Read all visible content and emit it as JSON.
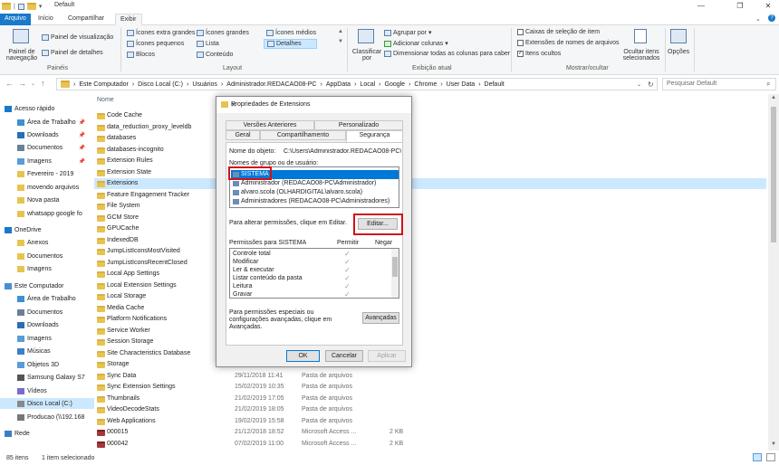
{
  "window": {
    "title": "Default"
  },
  "tabs": [
    {
      "label": "Arquivo"
    },
    {
      "label": "Início"
    },
    {
      "label": "Compartilhar"
    },
    {
      "label": "Exibir"
    }
  ],
  "ribbon": {
    "panes": {
      "nav_pane": "Painel de navegação",
      "preview_pane": "Painel de visualização",
      "details_pane": "Painel de detalhes",
      "group_label": "Painéis"
    },
    "layout": {
      "items": [
        "Ícones extra grandes",
        "Ícones grandes",
        "Ícones médios",
        "Ícones pequenos",
        "Lista",
        "Detalhes",
        "Blocos",
        "Conteúdo"
      ],
      "group_label": "Layout"
    },
    "current_view": {
      "sort_by": "Classificar por",
      "group_by": "Agrupar por",
      "add_columns": "Adicionar colunas",
      "size_columns": "Dimensionar todas as colunas para caber",
      "group_label": "Exibição atual"
    },
    "show_hide": {
      "item_checkboxes": "Caixas de seleção de item",
      "file_extensions": "Extensões de nomes de arquivos",
      "hidden_items": "Itens ocultos",
      "hide_selected": "Ocultar itens selecionados",
      "group_label": "Mostrar/ocultar"
    },
    "options": "Opções"
  },
  "address": {
    "crumbs": [
      "Este Computador",
      "Disco Local (C:)",
      "Usuários",
      "Administrador.REDACAO08-PC",
      "AppData",
      "Local",
      "Google",
      "Chrome",
      "User Data",
      "Default"
    ],
    "search_placeholder": "Pesquisar Default"
  },
  "nav": {
    "items": [
      {
        "label": "Acesso rápido",
        "pin": false
      },
      {
        "label": "Área de Trabalho",
        "pin": true
      },
      {
        "label": "Downloads",
        "pin": true
      },
      {
        "label": "Documentos",
        "pin": true
      },
      {
        "label": "Imagens",
        "pin": true
      },
      {
        "label": "Fevereiro - 2019",
        "pin": false
      },
      {
        "label": "movendo arquivos",
        "pin": false
      },
      {
        "label": "Nova pasta",
        "pin": false
      },
      {
        "label": "whatsapp google fo",
        "pin": false
      },
      {
        "label": "OneDrive",
        "pin": false
      },
      {
        "label": "Anexos",
        "pin": false
      },
      {
        "label": "Documentos",
        "pin": false
      },
      {
        "label": "Imagens",
        "pin": false
      },
      {
        "label": "Este Computador",
        "pin": false
      },
      {
        "label": "Área de Trabalho",
        "pin": false
      },
      {
        "label": "Documentos",
        "pin": false
      },
      {
        "label": "Downloads",
        "pin": false
      },
      {
        "label": "Imagens",
        "pin": false
      },
      {
        "label": "Músicas",
        "pin": false
      },
      {
        "label": "Objetos 3D",
        "pin": false
      },
      {
        "label": "Samsung Galaxy S7",
        "pin": false
      },
      {
        "label": "Vídeos",
        "pin": false
      },
      {
        "label": "Disco Local (C:)",
        "pin": false
      },
      {
        "label": "Producao (\\\\192.168",
        "pin": false
      },
      {
        "label": "Rede",
        "pin": false
      }
    ]
  },
  "files": {
    "col_name": "Nome",
    "rows": [
      {
        "name": "Code Cache",
        "date": "",
        "type": "",
        "size": ""
      },
      {
        "name": "data_reduction_proxy_leveldb",
        "date": "",
        "type": "",
        "size": ""
      },
      {
        "name": "databases",
        "date": "",
        "type": "",
        "size": ""
      },
      {
        "name": "databases-incognito",
        "date": "",
        "type": "",
        "size": ""
      },
      {
        "name": "Extension Rules",
        "date": "",
        "type": "",
        "size": ""
      },
      {
        "name": "Extension State",
        "date": "",
        "type": "",
        "size": ""
      },
      {
        "name": "Extensions",
        "date": "",
        "type": "",
        "size": ""
      },
      {
        "name": "Feature Engagement Tracker",
        "date": "",
        "type": "",
        "size": ""
      },
      {
        "name": "File System",
        "date": "",
        "type": "",
        "size": ""
      },
      {
        "name": "GCM Store",
        "date": "",
        "type": "",
        "size": ""
      },
      {
        "name": "GPUCache",
        "date": "",
        "type": "",
        "size": ""
      },
      {
        "name": "IndexedDB",
        "date": "",
        "type": "",
        "size": ""
      },
      {
        "name": "JumpListIconsMostVisited",
        "date": "",
        "type": "",
        "size": ""
      },
      {
        "name": "JumpListIconsRecentClosed",
        "date": "",
        "type": "",
        "size": ""
      },
      {
        "name": "Local App Settings",
        "date": "",
        "type": "",
        "size": ""
      },
      {
        "name": "Local Extension Settings",
        "date": "",
        "type": "",
        "size": ""
      },
      {
        "name": "Local Storage",
        "date": "",
        "type": "",
        "size": ""
      },
      {
        "name": "Media Cache",
        "date": "",
        "type": "",
        "size": ""
      },
      {
        "name": "Platform Notifications",
        "date": "",
        "type": "",
        "size": ""
      },
      {
        "name": "Service Worker",
        "date": "",
        "type": "",
        "size": ""
      },
      {
        "name": "Session Storage",
        "date": "",
        "type": "",
        "size": ""
      },
      {
        "name": "Site Characteristics Database",
        "date": "",
        "type": "",
        "size": ""
      },
      {
        "name": "Storage",
        "date": "",
        "type": "",
        "size": ""
      },
      {
        "name": "Sync Data",
        "date": "29/11/2018 11:41",
        "type": "Pasta de arquivos",
        "size": ""
      },
      {
        "name": "Sync Extension Settings",
        "date": "15/02/2019 10:35",
        "type": "Pasta de arquivos",
        "size": ""
      },
      {
        "name": "Thumbnails",
        "date": "21/02/2019 17:05",
        "type": "Pasta de arquivos",
        "size": ""
      },
      {
        "name": "VideoDecodeStats",
        "date": "21/02/2019 18:05",
        "type": "Pasta de arquivos",
        "size": ""
      },
      {
        "name": "Web Applications",
        "date": "19/02/2019 15:58",
        "type": "Pasta de arquivos",
        "size": ""
      },
      {
        "name": "000015",
        "date": "21/12/2018 18:52",
        "type": "Microsoft Access ...",
        "size": "2 KB"
      },
      {
        "name": "000042",
        "date": "07/02/2019 11:00",
        "type": "Microsoft Access ...",
        "size": "2 KB"
      }
    ]
  },
  "status": {
    "count": "85 itens",
    "selected": "1 item selecionado"
  },
  "dialog": {
    "title": "Propriedades de Extensions",
    "tabs": [
      "Versões Anteriores",
      "Personalizado",
      "Geral",
      "Compartilhamento",
      "Segurança"
    ],
    "object_label": "Nome do objeto:",
    "object_value": "C:\\Users\\Administrador.REDACAO08-PC\\AppI",
    "group_label": "Nomes de grupo ou de usuário:",
    "users": [
      "SISTEMA",
      "Administrador (REDACAO08-PC\\Administrador)",
      "alvaro.scola (OLHARDIGITAL\\alvaro.scola)",
      "Administradores (REDACAO08-PC\\Administradores)"
    ],
    "edit_hint": "Para alterar permissões, clique em Editar.",
    "edit_button": "Editar...",
    "perm_label": "Permissões para SISTEMA",
    "allow": "Permitir",
    "deny": "Negar",
    "permissions": [
      "Controle total",
      "Modificar",
      "Ler & executar",
      "Listar conteúdo da pasta",
      "Leitura",
      "Gravar"
    ],
    "adv_hint": "Para permissões especiais ou configurações avançadas, clique em Avançadas.",
    "advanced_button": "Avançadas",
    "ok": "OK",
    "cancel": "Cancelar",
    "apply": "Aplicar"
  }
}
